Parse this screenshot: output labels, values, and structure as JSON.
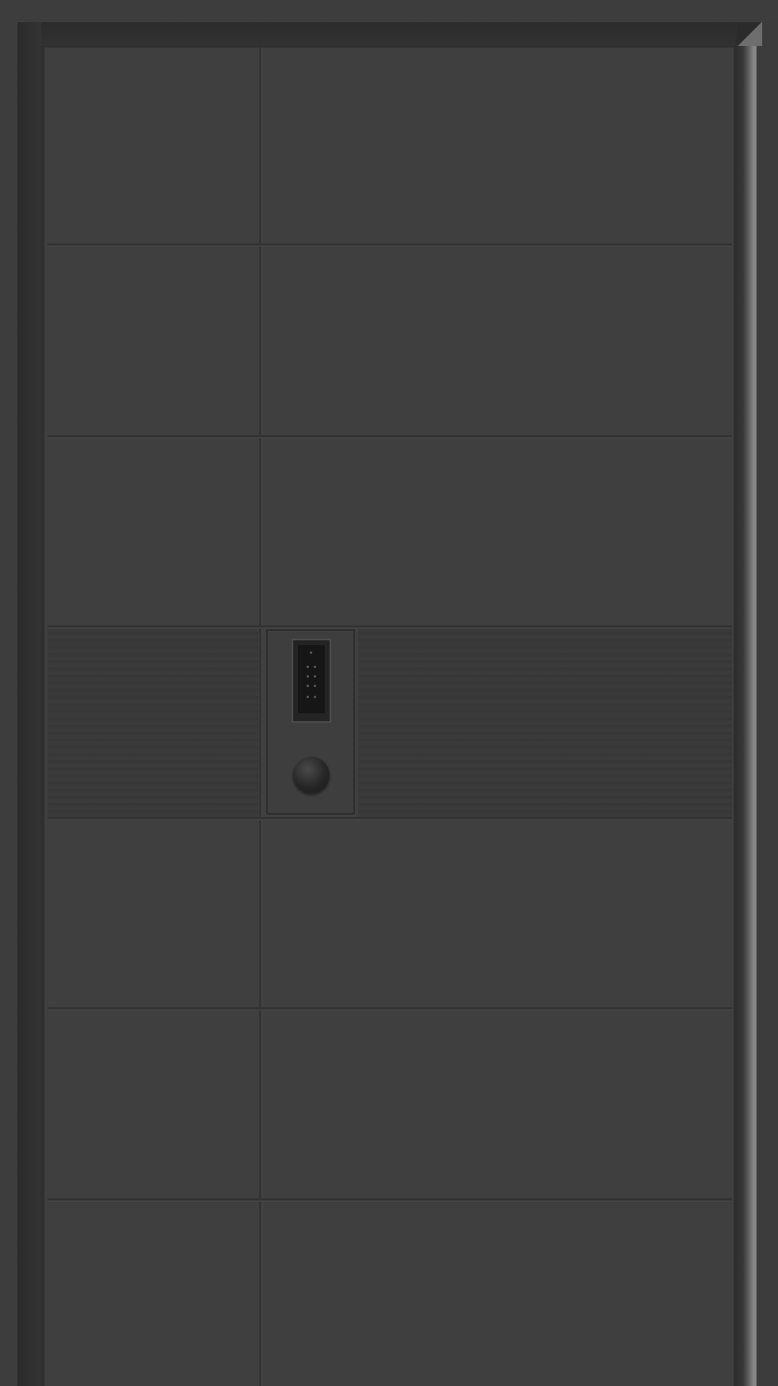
{
  "scene": {
    "subject": "door",
    "colors": {
      "door_panel": "#404040",
      "frame": "#2f2f2f",
      "frame_highlight": "#8b8b8b",
      "groove": "#333333",
      "keypad": "#242424",
      "knob": "#262626"
    },
    "icons": {
      "lock": "keypad-lock-icon",
      "knob": "door-knob-icon"
    }
  }
}
